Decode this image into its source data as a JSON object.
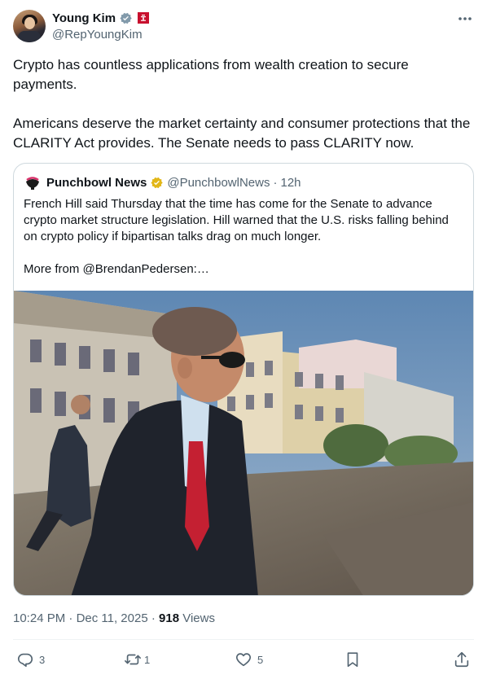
{
  "author": {
    "display_name": "Young Kim",
    "handle": "@RepYoungKim",
    "verified_icon": "blue-verified-badge",
    "flag_icon": "us-house-flag"
  },
  "tweet": {
    "text": "Crypto has countless applications from wealth creation to secure payments.\n\nAmericans deserve the market certainty and consumer protections that the CLARITY Act provides. The Senate needs to pass CLARITY now."
  },
  "quote": {
    "display_name": "Punchbowl News",
    "handle": "@PunchbowlNews",
    "separator": "·",
    "time": "12h",
    "text": "French Hill said Thursday that the time has come for the Senate to advance crypto market structure legislation. Hill warned that the U.S. risks falling behind on crypto policy if bipartisan talks drag on much longer.\n\nMore from @BrendanPedersen:…",
    "verified_icon": "gold-verified-badge"
  },
  "meta": {
    "time": "10:24 PM",
    "separator1": "·",
    "date": "Dec 11, 2025",
    "separator2": "·",
    "views_count": "918",
    "views_label": "Views"
  },
  "actions": {
    "replies": "3",
    "reposts": "1",
    "likes": "5"
  },
  "colors": {
    "text": "#0f1419",
    "secondary": "#536471",
    "border": "#cfd9de",
    "verified_blue": "#829aab",
    "gold": "#e2b719"
  }
}
